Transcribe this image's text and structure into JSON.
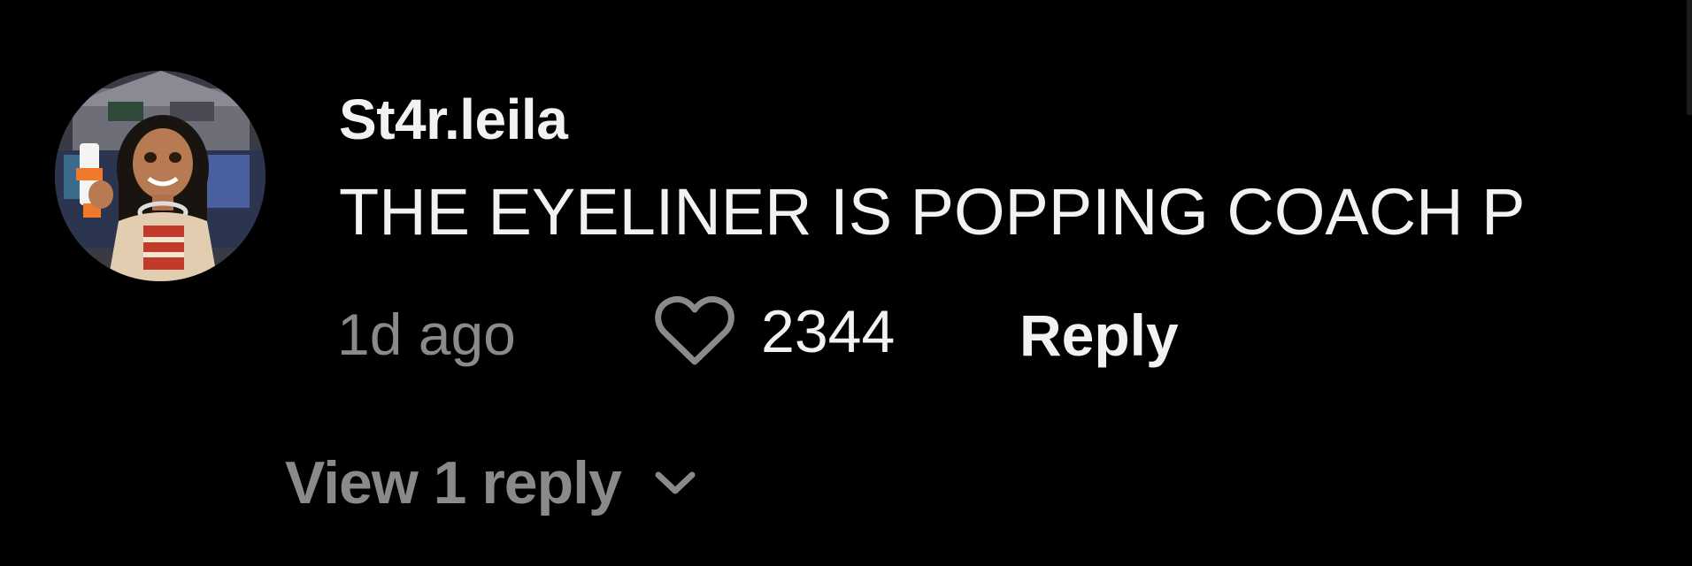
{
  "comment": {
    "username": "St4r.leila",
    "text": "THE EYELINER IS POPPING COACH P",
    "time": "1d ago",
    "likes": "2344",
    "reply_label": "Reply",
    "view_replies_label": "View 1 reply"
  },
  "icons": {
    "like": "heart-outline-icon",
    "expand": "chevron-down-icon"
  },
  "colors": {
    "background": "#000000",
    "primary_text": "#f2f2f2",
    "secondary_text": "#8a8a8a"
  }
}
